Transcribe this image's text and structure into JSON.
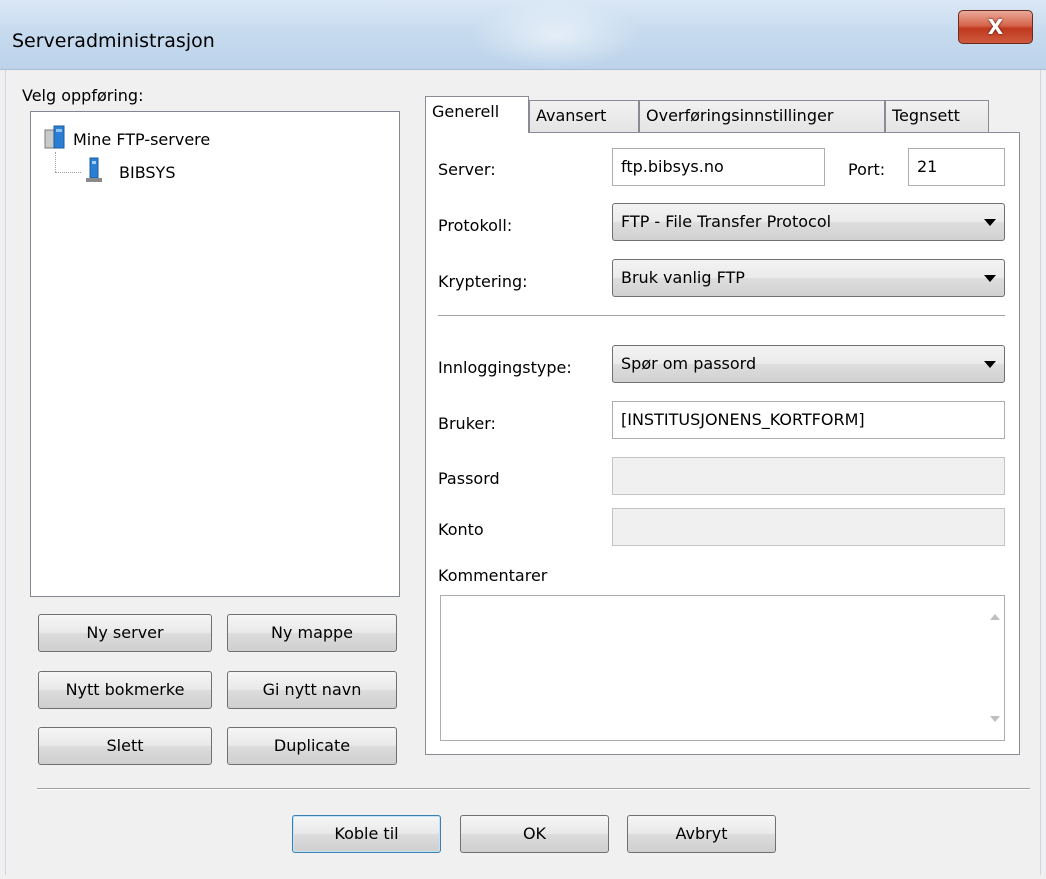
{
  "window": {
    "title": "Serveradministrasjon",
    "close_label": "X"
  },
  "tree": {
    "label": "Velg oppføring:",
    "root": "Mine FTP-servere",
    "child": "BIBSYS"
  },
  "left_buttons": {
    "new_server": "Ny server",
    "new_folder": "Ny mappe",
    "new_bookmark": "Nytt bokmerke",
    "rename": "Gi nytt navn",
    "delete": "Slett",
    "duplicate": "Duplicate"
  },
  "tabs": [
    "Generell",
    "Avansert",
    "Overføringsinnstillinger",
    "Tegnsett"
  ],
  "general": {
    "server_label": "Server:",
    "server_value": "ftp.bibsys.no",
    "port_label": "Port:",
    "port_value": "21",
    "protocol_label": "Protokoll:",
    "protocol_value": "FTP - File Transfer Protocol",
    "encryption_label": "Kryptering:",
    "encryption_value": "Bruk vanlig FTP",
    "logon_type_label": "Innloggingstype:",
    "logon_type_value": "Spør om passord",
    "user_label": "Bruker:",
    "user_value": "[INSTITUSJONENS_KORTFORM]",
    "password_label": "Passord",
    "account_label": "Konto",
    "comments_label": "Kommentarer"
  },
  "bottom_buttons": {
    "connect": "Koble til",
    "ok": "OK",
    "cancel": "Avbryt"
  }
}
